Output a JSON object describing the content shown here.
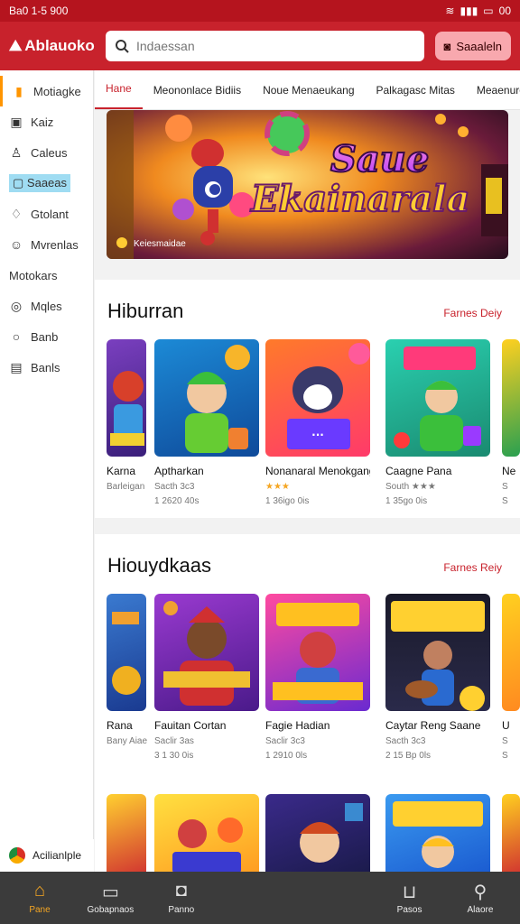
{
  "status": {
    "time": "Ba0 1-5 900",
    "battery": "00"
  },
  "app": {
    "name": "Ablauoko",
    "search_placeholder": "Indaessan",
    "action_label": "Saaaleln"
  },
  "sidebar": {
    "items": [
      {
        "label": "Motiagke",
        "icon": "book-icon"
      },
      {
        "label": "Kaiz",
        "icon": "box-icon"
      },
      {
        "label": "Caleus",
        "icon": "person-icon"
      },
      {
        "label": "Saaeas",
        "icon": "square-icon"
      },
      {
        "label": "Gtolant",
        "icon": "chat-icon"
      },
      {
        "label": "Mvrenlas",
        "icon": "smile-icon"
      },
      {
        "label": "Motokars",
        "icon": ""
      },
      {
        "label": "Mqles",
        "icon": "pin-icon"
      },
      {
        "label": "Banb",
        "icon": "search-icon"
      },
      {
        "label": "Banls",
        "icon": "gift-icon"
      }
    ],
    "bottom_app": "Acilianlple"
  },
  "tabs": [
    "Hane",
    "Meononlace Bidiis",
    "Noue Menaeukang",
    "Palkagasc Mitas",
    "Meaenuro"
  ],
  "banner": {
    "title_line1": "Saue",
    "title_line2": "Ekainarala",
    "caption": "Keiesmaidae"
  },
  "sections": [
    {
      "title": "Hiburran",
      "link": "Farnes Deiy",
      "cards": [
        {
          "name": "Karna",
          "meta1": "",
          "meta2": "Barleigan"
        },
        {
          "name": "Aptharkan",
          "meta1": "Sacth 3c3",
          "meta2": "1 2620 40s"
        },
        {
          "name": "Nonanaral Menokgang",
          "meta1": "★★★",
          "meta2": "1 36igo 0is"
        },
        {
          "name": "Caagne Pana",
          "meta1": "South ★★★",
          "meta2": "1 35go 0is"
        },
        {
          "name": "Ne",
          "meta1": "S",
          "meta2": "S"
        }
      ]
    },
    {
      "title": "Hiouydkaas",
      "link": "Farnes Reiy",
      "cards": [
        {
          "name": "Rana",
          "meta1": "",
          "meta2": "Bany Aiae"
        },
        {
          "name": "Fauitan Cortan",
          "meta1": "Saclir 3as",
          "meta2": "3 1 30 0is"
        },
        {
          "name": "Fagie Hadian",
          "meta1": "Saclir 3c3",
          "meta2": "1 2910 0ls"
        },
        {
          "name": "Caytar Reng Saane",
          "meta1": "Sacth 3c3",
          "meta2": "2 15 Bp 0ls"
        },
        {
          "name": "U",
          "meta1": "S",
          "meta2": "S"
        }
      ]
    }
  ],
  "bottom_nav": [
    {
      "label": "Pane",
      "icon": "home-icon"
    },
    {
      "label": "Gobapnaos",
      "icon": "tablet-icon"
    },
    {
      "label": "Panno",
      "icon": "game-icon"
    },
    {
      "label": "Pasos",
      "icon": "basket-icon"
    },
    {
      "label": "Alaore",
      "icon": "search-icon"
    }
  ],
  "colors": {
    "brand": "#c8222c",
    "accent": "#f5a623",
    "nav_bg": "#3b3b3b"
  }
}
